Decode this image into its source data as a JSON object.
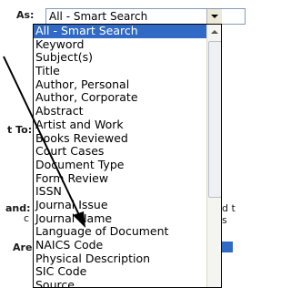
{
  "form": {
    "search_as_label": "As:",
    "sort_to_label": "t To:",
    "expand_label": "and:",
    "area_label": "Area:",
    "expand_fragment_1": "d t",
    "expand_fragment_2": "s",
    "expand_fragment_3": "c"
  },
  "search_type_select": {
    "value": "All - Smart Search",
    "options": [
      "All - Smart Search",
      "Keyword",
      "Subject(s)",
      "Title",
      "Author, Personal",
      "Author, Corporate",
      "Abstract",
      "Artist and Work",
      "Books Reviewed",
      "Court Cases",
      "Document Type",
      "Form Review",
      "ISSN",
      "Journal Issue",
      "Journal Name",
      "Language of Document",
      "NAICS Code",
      "Physical Description",
      "SIC Code",
      "Source"
    ],
    "selected_index": 0
  },
  "colors": {
    "selection": "#316ac5",
    "border": "#7f9db9",
    "arrow": "#000000"
  },
  "annotation": {
    "icon": "arrow-pointer-icon",
    "target": "Journal Name"
  }
}
